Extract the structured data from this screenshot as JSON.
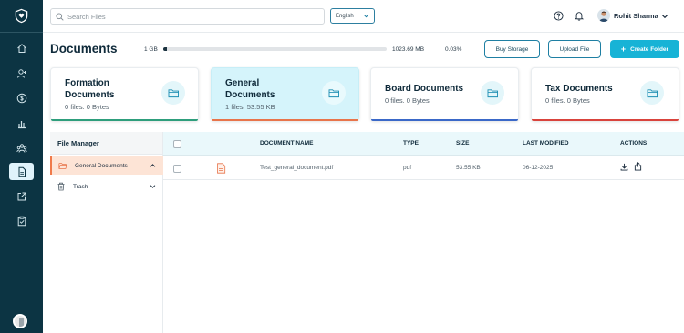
{
  "search": {
    "placeholder": "Search Files"
  },
  "language": {
    "selected": "English"
  },
  "user": {
    "name": "Rohit Sharma"
  },
  "page": {
    "title": "Documents"
  },
  "storage": {
    "total": "1 GB",
    "free": "1023.69 MB",
    "used_percent": "0.03%",
    "used_fraction": 0.0003
  },
  "buttons": {
    "buy_storage": "Buy Storage",
    "upload_file": "Upload File",
    "create_folder": "Create Folder"
  },
  "folders": [
    {
      "title_line1": "Formation",
      "title_line2": "Documents",
      "meta": "0 files. 0 Bytes",
      "accent": "#2e9e7c"
    },
    {
      "title_line1": "General",
      "title_line2": "Documents",
      "meta": "1 files. 53.55 KB",
      "accent": "#e8744a"
    },
    {
      "title_line1": "Board Documents",
      "title_line2": "",
      "meta": "0 files. 0 Bytes",
      "accent": "#3a68c8"
    },
    {
      "title_line1": "Tax Documents",
      "title_line2": "",
      "meta": "0 files. 0 Bytes",
      "accent": "#d9433c"
    }
  ],
  "file_manager": {
    "title": "File Manager",
    "items": [
      {
        "label": "General Documents",
        "icon": "folder-open-icon"
      },
      {
        "label": "Trash",
        "icon": "trash-icon"
      }
    ]
  },
  "table": {
    "headers": {
      "name": "DOCUMENT NAME",
      "type": "TYPE",
      "size": "SIZE",
      "modified": "LAST MODIFIED",
      "actions": "ACTIONS"
    },
    "rows": [
      {
        "name": "Test_general_document.pdf",
        "type": "pdf",
        "size": "53.55 KB",
        "modified": "06-12-2025",
        "file_icon": "pdf-file-icon"
      }
    ]
  },
  "colors": {
    "sidebar": "#0c3443",
    "accent": "#17b3d6",
    "active_card": "#d5f4fb"
  }
}
